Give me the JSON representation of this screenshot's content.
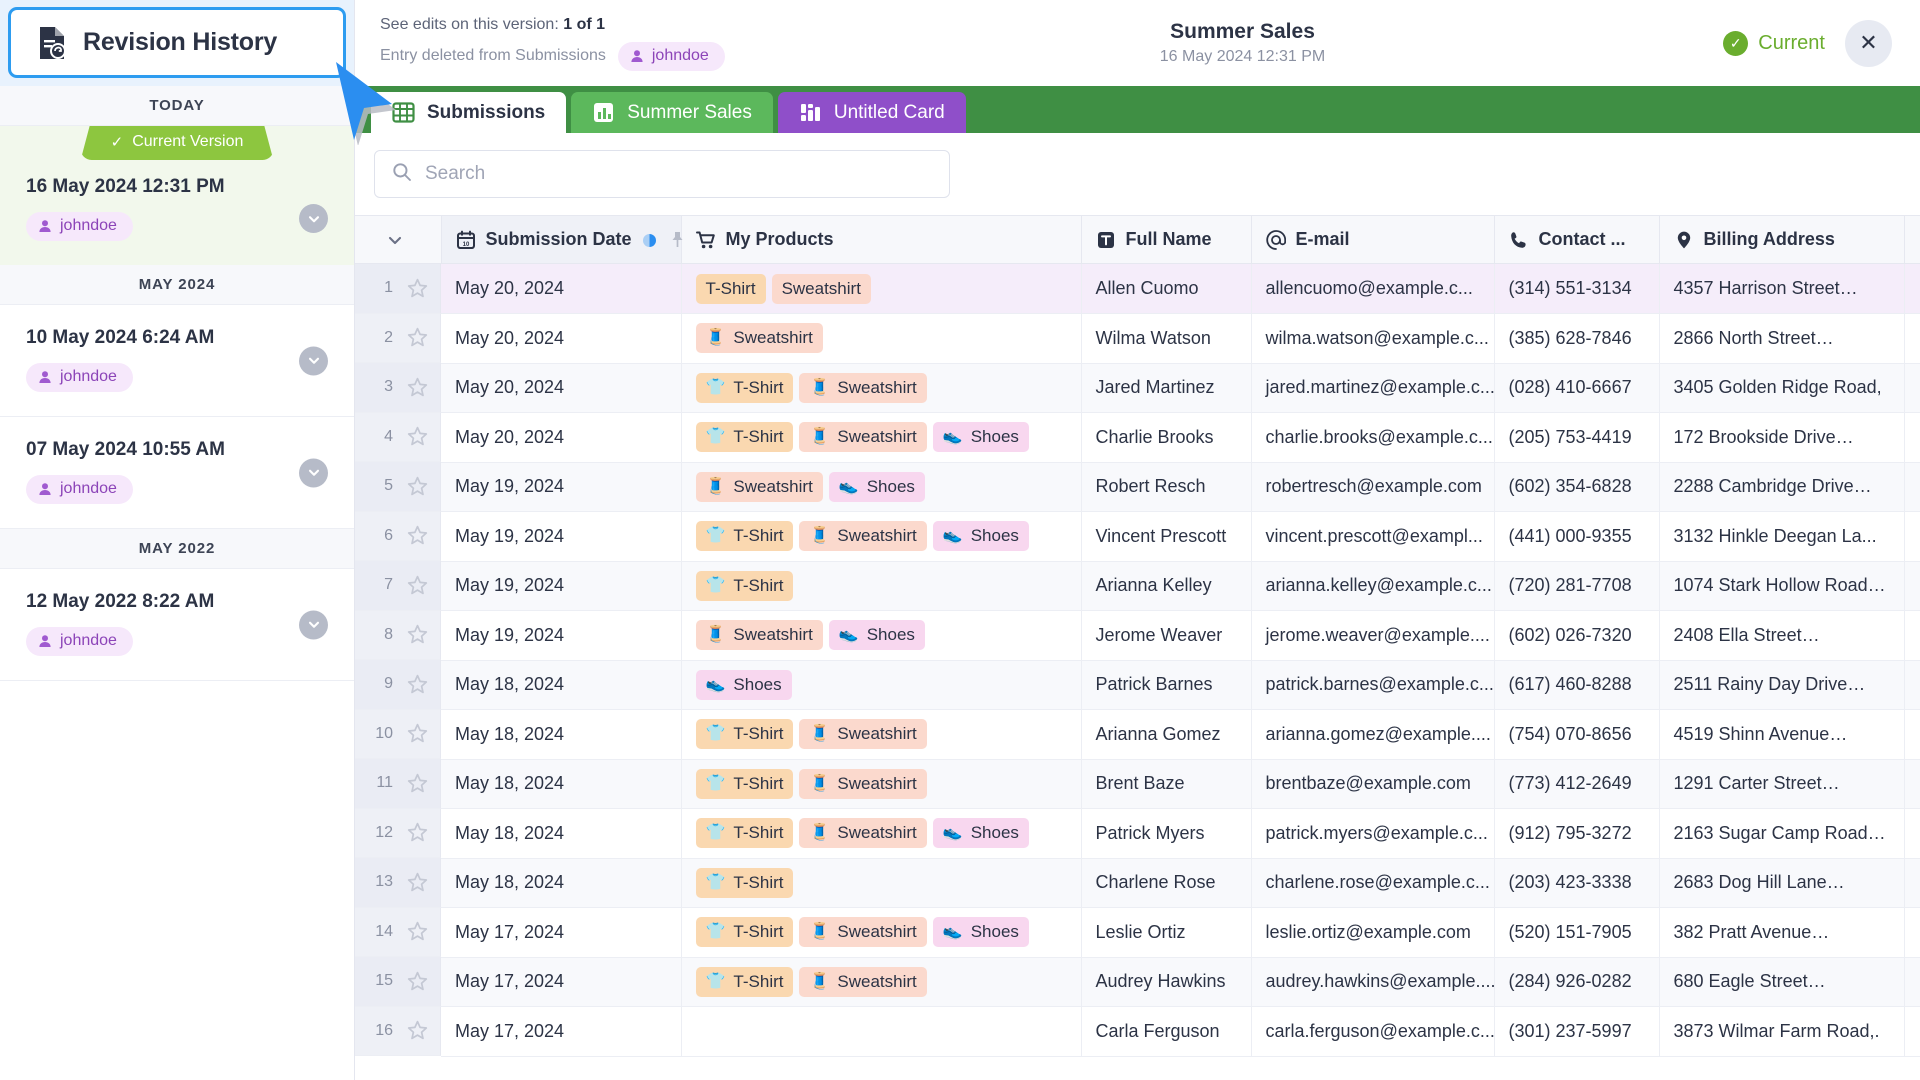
{
  "sidebar": {
    "panel_title": "Revision History",
    "groups": [
      {
        "label": "TODAY",
        "items": [
          {
            "date": "16 May 2024 12:31 PM",
            "user": "johndoe",
            "current": true,
            "ribbon": "Current Version"
          }
        ]
      },
      {
        "label": "MAY 2024",
        "items": [
          {
            "date": "10 May 2024 6:24 AM",
            "user": "johndoe",
            "current": false
          },
          {
            "date": "07 May 2024 10:55 AM",
            "user": "johndoe",
            "current": false
          }
        ]
      },
      {
        "label": "MAY 2022",
        "items": [
          {
            "date": "12 May 2022 8:22 AM",
            "user": "johndoe",
            "current": false
          }
        ]
      }
    ]
  },
  "topbar": {
    "edits_label": "See edits on this version:",
    "edits_count": "1 of 1",
    "change_text": "Entry deleted from Submissions",
    "change_user": "johndoe",
    "title": "Summer Sales",
    "subtitle": "16 May 2024 12:31 PM",
    "status_label": "Current",
    "close_label": "✕",
    "status_color": "#6aad2e"
  },
  "tabs": [
    {
      "label": "Submissions",
      "style": "active",
      "icon": "grid-icon"
    },
    {
      "label": "Summer Sales",
      "style": "green",
      "icon": "bar-chart-icon"
    },
    {
      "label": "Untitled Card",
      "style": "purple",
      "icon": "card-chart-icon"
    }
  ],
  "search": {
    "placeholder": "Search"
  },
  "table": {
    "columns": [
      {
        "label": "",
        "icon": "chevron-down-icon",
        "key": "idx"
      },
      {
        "label": "Submission Date",
        "icon": "calendar-icon",
        "sorted": true,
        "pinned": true
      },
      {
        "label": "My Products",
        "icon": "cart-icon"
      },
      {
        "label": "Full Name",
        "icon": "text-icon"
      },
      {
        "label": "E-mail",
        "icon": "at-icon"
      },
      {
        "label": "Contact ...",
        "icon": "phone-icon"
      },
      {
        "label": "Billing Address",
        "icon": "pin-icon"
      },
      {
        "label": "",
        "icon": "tag-icon"
      }
    ],
    "rows": [
      {
        "n": "1",
        "date": "May 20, 2024",
        "products": [
          "T-Shirt",
          "Sweatshirt"
        ],
        "name": "Allen Cuomo",
        "email": "allencuomo@example.c...",
        "phone": "(314) 551-3134",
        "address": "4357 Harrison Street…",
        "deleted": true
      },
      {
        "n": "2",
        "date": "May 20, 2024",
        "products": [
          "Sweatshirt"
        ],
        "name": "Wilma Watson",
        "email": "wilma.watson@example.c...",
        "phone": "(385) 628-7846",
        "address": "2866 North Street…"
      },
      {
        "n": "3",
        "date": "May 20, 2024",
        "products": [
          "T-Shirt",
          "Sweatshirt"
        ],
        "name": "Jared Martinez",
        "email": "jared.martinez@example.c...",
        "phone": "(028) 410-6667",
        "address": "3405 Golden Ridge Road,"
      },
      {
        "n": "4",
        "date": "May 20, 2024",
        "products": [
          "T-Shirt",
          "Sweatshirt",
          "Shoes"
        ],
        "name": "Charlie Brooks",
        "email": "charlie.brooks@example.c...",
        "phone": "(205) 753-4419",
        "address": "172 Brookside Drive…"
      },
      {
        "n": "5",
        "date": "May 19, 2024",
        "products": [
          "Sweatshirt",
          "Shoes"
        ],
        "name": "Robert Resch",
        "email": "robertresch@example.com",
        "phone": "(602) 354-6828",
        "address": "2288 Cambridge Drive…"
      },
      {
        "n": "6",
        "date": "May 19, 2024",
        "products": [
          "T-Shirt",
          "Sweatshirt",
          "Shoes"
        ],
        "name": "Vincent Prescott",
        "email": "vincent.prescott@exampl...",
        "phone": "(441) 000-9355",
        "address": "3132 Hinkle Deegan La..."
      },
      {
        "n": "7",
        "date": "May 19, 2024",
        "products": [
          "T-Shirt"
        ],
        "name": "Arianna Kelley",
        "email": "arianna.kelley@example.c...",
        "phone": "(720) 281-7708",
        "address": "1074 Stark Hollow Road…"
      },
      {
        "n": "8",
        "date": "May 19, 2024",
        "products": [
          "Sweatshirt",
          "Shoes"
        ],
        "name": "Jerome Weaver",
        "email": "jerome.weaver@example....",
        "phone": "(602) 026-7320",
        "address": "2408 Ella Street…"
      },
      {
        "n": "9",
        "date": "May 18, 2024",
        "products": [
          "Shoes"
        ],
        "name": "Patrick Barnes",
        "email": "patrick.barnes@example.c...",
        "phone": "(617) 460-8288",
        "address": "2511 Rainy Day Drive…"
      },
      {
        "n": "10",
        "date": "May 18, 2024",
        "products": [
          "T-Shirt",
          "Sweatshirt"
        ],
        "name": "Arianna Gomez",
        "email": "arianna.gomez@example....",
        "phone": "(754) 070-8656",
        "address": "4519 Shinn Avenue…"
      },
      {
        "n": "11",
        "date": "May 18, 2024",
        "products": [
          "T-Shirt",
          "Sweatshirt"
        ],
        "name": "Brent Baze",
        "email": "brentbaze@example.com",
        "phone": "(773) 412-2649",
        "address": "1291 Carter Street…"
      },
      {
        "n": "12",
        "date": "May 18, 2024",
        "products": [
          "T-Shirt",
          "Sweatshirt",
          "Shoes"
        ],
        "name": "Patrick Myers",
        "email": "patrick.myers@example.c...",
        "phone": "(912) 795-3272",
        "address": "2163 Sugar Camp Road…"
      },
      {
        "n": "13",
        "date": "May 18, 2024",
        "products": [
          "T-Shirt"
        ],
        "name": "Charlene Rose",
        "email": "charlene.rose@example.c...",
        "phone": "(203) 423-3338",
        "address": "2683 Dog Hill Lane…"
      },
      {
        "n": "14",
        "date": "May 17, 2024",
        "products": [
          "T-Shirt",
          "Sweatshirt",
          "Shoes"
        ],
        "name": "Leslie Ortiz",
        "email": "leslie.ortiz@example.com",
        "phone": "(520) 151-7905",
        "address": "382 Pratt Avenue…"
      },
      {
        "n": "15",
        "date": "May 17, 2024",
        "products": [
          "T-Shirt",
          "Sweatshirt"
        ],
        "name": "Audrey Hawkins",
        "email": "audrey.hawkins@example....",
        "phone": "(284) 926-0282",
        "address": "680 Eagle Street…"
      },
      {
        "n": "16",
        "date": "May 17, 2024",
        "products": [],
        "name": "Carla Ferguson",
        "email": "carla.ferguson@example.c...",
        "phone": "(301) 237-5997",
        "address": "3873 Wilmar Farm Road,."
      }
    ],
    "product_styles": {
      "T-Shirt": "tshirt",
      "Sweatshirt": "sweat",
      "Shoes": "shoes"
    },
    "product_emoji": {
      "T-Shirt": "👕",
      "Sweatshirt": "🧵",
      "Shoes": "👟"
    }
  },
  "colors": {
    "tab_green": "#3f8f44",
    "tshirt_tag": "#fad8b0",
    "sweatshirt_tag": "#fbd9cd",
    "shoes_tag": "#f8d7ef",
    "ribbon_green": "#8dc63f",
    "accent_blue": "#2d9cf0",
    "user_chip": "#8c44b8"
  }
}
